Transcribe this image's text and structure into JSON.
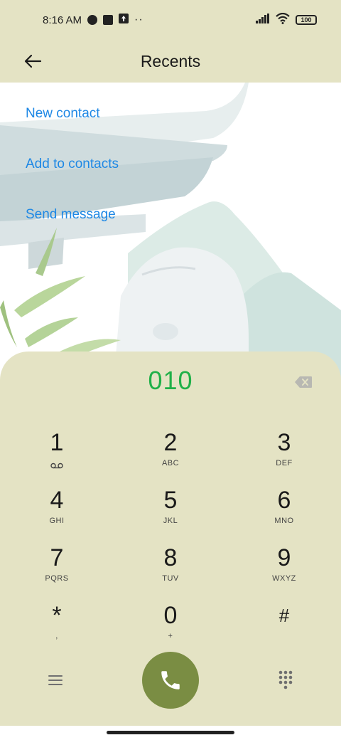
{
  "status": {
    "time": "8:16 AM",
    "battery": "100"
  },
  "header": {
    "title": "Recents"
  },
  "actions": [
    {
      "label": "New contact"
    },
    {
      "label": "Add to contacts"
    },
    {
      "label": "Send message"
    }
  ],
  "dialer": {
    "number": "010",
    "keys": [
      {
        "digit": "1",
        "letters": "",
        "icon": "voicemail-icon"
      },
      {
        "digit": "2",
        "letters": "ABC"
      },
      {
        "digit": "3",
        "letters": "DEF"
      },
      {
        "digit": "4",
        "letters": "GHI"
      },
      {
        "digit": "5",
        "letters": "JKL"
      },
      {
        "digit": "6",
        "letters": "MNO"
      },
      {
        "digit": "7",
        "letters": "PQRS"
      },
      {
        "digit": "8",
        "letters": "TUV"
      },
      {
        "digit": "9",
        "letters": "WXYZ"
      },
      {
        "digit": "*",
        "letters": ","
      },
      {
        "digit": "0",
        "letters": "+"
      },
      {
        "digit": "#",
        "letters": ""
      }
    ]
  },
  "colors": {
    "panel": "#e4e3c4",
    "accent_link": "#1e88e5",
    "number": "#20b048",
    "call_button": "#7a8d43"
  }
}
